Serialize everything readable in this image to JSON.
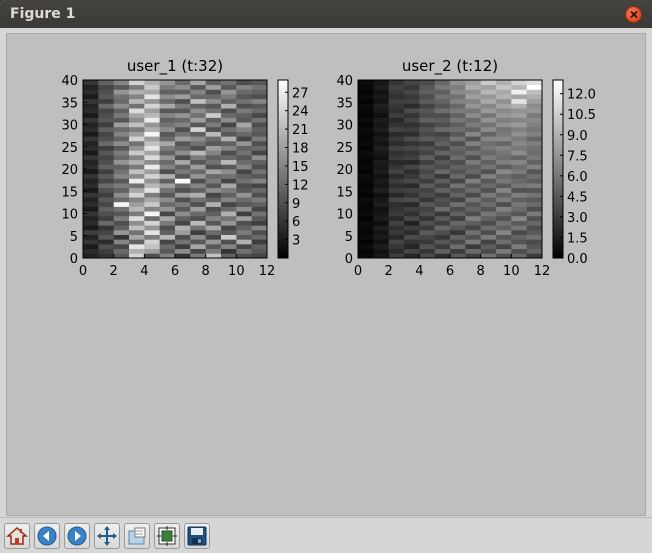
{
  "window": {
    "title": "Figure 1"
  },
  "toolbar": {
    "buttons": [
      {
        "name": "home-icon",
        "label": "Home"
      },
      {
        "name": "back-icon",
        "label": "Back"
      },
      {
        "name": "forward-icon",
        "label": "Forward"
      },
      {
        "name": "pan-icon",
        "label": "Pan"
      },
      {
        "name": "zoom-icon",
        "label": "Zoom"
      },
      {
        "name": "subplots-icon",
        "label": "Configure subplots"
      },
      {
        "name": "save-icon",
        "label": "Save"
      }
    ]
  },
  "chart_data": [
    {
      "type": "heatmap",
      "title": "user_1 (t:32)",
      "colormap": "gray",
      "xlim": [
        0,
        12
      ],
      "ylim": [
        0,
        40
      ],
      "x_ticks": [
        "0",
        "2",
        "4",
        "6",
        "8",
        "10",
        "12"
      ],
      "y_ticks": [
        "0",
        "5",
        "10",
        "15",
        "20",
        "25",
        "30",
        "35",
        "40"
      ],
      "colorbar": {
        "ticks": [
          "3",
          "6",
          "9",
          "12",
          "15",
          "18",
          "21",
          "24",
          "27"
        ],
        "range": [
          0,
          29
        ]
      },
      "values": [
        [
          4,
          6,
          10,
          24,
          9,
          15,
          6,
          14,
          22,
          11,
          9,
          8
        ],
        [
          5,
          7,
          12,
          20,
          18,
          10,
          16,
          8,
          14,
          6,
          13,
          10
        ],
        [
          3,
          9,
          8,
          26,
          22,
          12,
          7,
          19,
          10,
          15,
          8,
          11
        ],
        [
          6,
          5,
          15,
          11,
          24,
          8,
          13,
          10,
          17,
          9,
          20,
          7
        ],
        [
          4,
          10,
          6,
          19,
          14,
          21,
          9,
          16,
          8,
          23,
          10,
          12
        ],
        [
          7,
          8,
          17,
          13,
          26,
          11,
          18,
          7,
          12,
          10,
          14,
          9
        ],
        [
          3,
          6,
          11,
          22,
          17,
          9,
          20,
          13,
          19,
          8,
          11,
          15
        ],
        [
          5,
          12,
          9,
          16,
          24,
          14,
          8,
          21,
          10,
          17,
          9,
          7
        ],
        [
          4,
          7,
          14,
          25,
          12,
          19,
          11,
          9,
          15,
          13,
          18,
          10
        ],
        [
          6,
          9,
          10,
          14,
          28,
          8,
          16,
          12,
          11,
          20,
          7,
          13
        ],
        [
          3,
          11,
          13,
          21,
          15,
          17,
          10,
          18,
          9,
          12,
          16,
          8
        ],
        [
          5,
          8,
          28,
          18,
          23,
          12,
          14,
          9,
          20,
          8,
          10,
          11
        ],
        [
          4,
          10,
          12,
          15,
          19,
          16,
          9,
          13,
          11,
          15,
          12,
          14
        ],
        [
          6,
          7,
          16,
          24,
          14,
          10,
          18,
          20,
          8,
          11,
          17,
          9
        ],
        [
          3,
          9,
          11,
          19,
          26,
          13,
          9,
          11,
          16,
          14,
          10,
          12
        ],
        [
          5,
          12,
          14,
          13,
          21,
          18,
          12,
          15,
          10,
          19,
          9,
          8
        ],
        [
          4,
          8,
          10,
          27,
          17,
          11,
          29,
          9,
          14,
          8,
          13,
          15
        ],
        [
          6,
          10,
          15,
          16,
          24,
          20,
          10,
          17,
          12,
          13,
          11,
          10
        ],
        [
          3,
          7,
          13,
          22,
          18,
          9,
          14,
          12,
          19,
          16,
          8,
          13
        ],
        [
          5,
          11,
          11,
          14,
          27,
          15,
          11,
          18,
          9,
          10,
          15,
          9
        ],
        [
          4,
          9,
          17,
          20,
          16,
          12,
          19,
          10,
          13,
          21,
          12,
          11
        ],
        [
          6,
          8,
          12,
          15,
          25,
          17,
          9,
          14,
          11,
          12,
          10,
          16
        ],
        [
          3,
          10,
          14,
          23,
          19,
          11,
          16,
          21,
          15,
          9,
          13,
          8
        ],
        [
          5,
          7,
          10,
          17,
          26,
          14,
          12,
          9,
          18,
          15,
          11,
          12
        ],
        [
          4,
          12,
          16,
          13,
          22,
          19,
          10,
          13,
          10,
          11,
          17,
          9
        ],
        [
          6,
          9,
          11,
          24,
          18,
          12,
          18,
          16,
          12,
          20,
          8,
          14
        ],
        [
          3,
          8,
          15,
          18,
          28,
          10,
          13,
          11,
          21,
          10,
          12,
          10
        ],
        [
          5,
          11,
          12,
          14,
          20,
          16,
          9,
          24,
          9,
          13,
          15,
          11
        ],
        [
          4,
          7,
          18,
          22,
          17,
          13,
          15,
          10,
          14,
          8,
          19,
          9
        ],
        [
          6,
          10,
          10,
          16,
          27,
          11,
          12,
          18,
          11,
          16,
          10,
          13
        ],
        [
          3,
          9,
          14,
          19,
          21,
          15,
          17,
          13,
          23,
          12,
          11,
          8
        ],
        [
          5,
          8,
          11,
          25,
          18,
          10,
          10,
          16,
          13,
          9,
          14,
          12
        ],
        [
          4,
          12,
          16,
          13,
          24,
          19,
          14,
          11,
          10,
          20,
          9,
          10
        ],
        [
          6,
          7,
          12,
          21,
          17,
          12,
          9,
          22,
          16,
          11,
          13,
          15
        ],
        [
          3,
          10,
          13,
          15,
          26,
          16,
          18,
          12,
          12,
          14,
          10,
          9
        ],
        [
          5,
          9,
          17,
          20,
          19,
          11,
          11,
          15,
          9,
          17,
          12,
          11
        ],
        [
          4,
          8,
          10,
          14,
          23,
          14,
          16,
          10,
          18,
          10,
          15,
          13
        ],
        [
          6,
          11,
          15,
          24,
          20,
          17,
          12,
          19,
          11,
          13,
          9,
          10
        ]
      ]
    },
    {
      "type": "heatmap",
      "title": "user_2 (t:12)",
      "colormap": "gray",
      "xlim": [
        0,
        12
      ],
      "ylim": [
        0,
        40
      ],
      "x_ticks": [
        "0",
        "2",
        "4",
        "6",
        "8",
        "10",
        "12"
      ],
      "y_ticks": [
        "0",
        "5",
        "10",
        "15",
        "20",
        "25",
        "30",
        "35",
        "40"
      ],
      "colorbar": {
        "ticks": [
          "0.0",
          "1.5",
          "3.0",
          "4.5",
          "6.0",
          "7.5",
          "9.0",
          "10.5",
          "12.0"
        ],
        "range": [
          0,
          13
        ]
      },
      "values": [
        [
          0.4,
          1.2,
          3.1,
          2.0,
          3.8,
          2.4,
          4.6,
          3.2,
          5.9,
          4.1,
          5.2,
          3.0
        ],
        [
          0.3,
          0.9,
          2.2,
          3.5,
          2.7,
          4.9,
          3.1,
          5.4,
          3.8,
          6.2,
          4.0,
          5.1
        ],
        [
          0.6,
          1.5,
          2.8,
          1.9,
          4.2,
          3.0,
          5.6,
          2.9,
          4.8,
          3.5,
          6.4,
          4.4
        ],
        [
          0.2,
          0.8,
          3.4,
          2.6,
          2.9,
          4.4,
          3.7,
          6.1,
          3.4,
          5.6,
          4.3,
          3.8
        ],
        [
          0.5,
          1.3,
          2.0,
          3.8,
          3.5,
          2.8,
          5.0,
          4.2,
          6.3,
          4.4,
          5.1,
          5.7
        ],
        [
          0.3,
          1.0,
          2.9,
          2.3,
          4.6,
          3.9,
          2.8,
          5.7,
          4.0,
          6.8,
          3.7,
          4.6
        ],
        [
          0.4,
          1.6,
          2.4,
          3.1,
          3.0,
          5.2,
          4.4,
          3.6,
          5.5,
          4.9,
          6.0,
          3.9
        ],
        [
          0.6,
          0.7,
          3.3,
          1.8,
          4.1,
          3.3,
          5.3,
          4.8,
          3.9,
          5.8,
          4.6,
          5.3
        ],
        [
          0.2,
          1.4,
          2.1,
          3.6,
          2.6,
          4.6,
          3.2,
          6.4,
          5.0,
          4.2,
          6.9,
          4.1
        ],
        [
          0.5,
          1.1,
          3.0,
          2.5,
          3.9,
          2.9,
          4.9,
          3.9,
          6.0,
          5.3,
          4.4,
          6.2
        ],
        [
          0.3,
          0.9,
          2.6,
          3.2,
          3.3,
          5.5,
          3.8,
          5.1,
          4.3,
          6.6,
          5.5,
          4.0
        ],
        [
          0.4,
          1.5,
          2.3,
          2.1,
          4.5,
          3.7,
          5.7,
          4.4,
          5.6,
          3.9,
          6.1,
          5.4
        ],
        [
          0.6,
          1.2,
          3.5,
          3.9,
          2.8,
          4.2,
          3.4,
          6.0,
          4.7,
          6.3,
          4.9,
          4.5
        ],
        [
          0.2,
          0.8,
          2.0,
          2.7,
          4.0,
          3.1,
          5.1,
          3.7,
          6.2,
          5.0,
          6.5,
          5.9
        ],
        [
          0.5,
          1.6,
          3.2,
          3.4,
          3.4,
          5.0,
          4.1,
          5.6,
          4.1,
          6.9,
          4.2,
          4.3
        ],
        [
          0.3,
          1.0,
          2.4,
          2.2,
          4.7,
          3.5,
          5.8,
          4.5,
          5.4,
          4.6,
          6.0,
          6.3
        ],
        [
          0.4,
          1.3,
          3.1,
          3.7,
          3.1,
          4.8,
          3.6,
          6.5,
          4.5,
          6.1,
          5.3,
          4.8
        ],
        [
          0.6,
          0.9,
          2.2,
          2.9,
          4.3,
          2.9,
          5.4,
          3.8,
          6.6,
          5.4,
          4.8,
          5.6
        ],
        [
          0.2,
          1.5,
          3.4,
          2.4,
          3.6,
          5.3,
          4.3,
          5.3,
          4.2,
          7.0,
          6.2,
          4.4
        ],
        [
          0.5,
          1.1,
          2.7,
          3.5,
          4.4,
          3.8,
          5.0,
          4.9,
          5.9,
          4.7,
          5.5,
          6.6
        ],
        [
          0.3,
          1.4,
          2.1,
          2.0,
          3.2,
          4.5,
          3.9,
          6.2,
          4.9,
          6.4,
          6.8,
          5.0
        ],
        [
          0.4,
          0.8,
          3.0,
          3.3,
          4.8,
          3.2,
          5.5,
          4.1,
          6.3,
          5.6,
          5.1,
          6.1
        ],
        [
          0.6,
          1.2,
          2.5,
          2.8,
          3.5,
          5.1,
          4.7,
          5.8,
          5.3,
          6.0,
          7.2,
          5.5
        ],
        [
          0.2,
          1.6,
          3.3,
          3.6,
          4.1,
          3.6,
          5.2,
          4.6,
          6.1,
          6.7,
          6.1,
          5.8
        ],
        [
          0.5,
          1.0,
          2.3,
          2.6,
          3.0,
          4.9,
          4.0,
          6.6,
          5.6,
          5.2,
          6.9,
          6.4
        ],
        [
          0.3,
          1.3,
          2.9,
          3.9,
          4.6,
          4.3,
          5.9,
          4.3,
          6.8,
          6.9,
          6.3,
          5.2
        ],
        [
          0.4,
          0.9,
          2.2,
          2.3,
          3.7,
          3.4,
          4.5,
          6.9,
          5.1,
          6.2,
          7.4,
          6.7
        ],
        [
          0.6,
          1.5,
          3.4,
          3.1,
          4.2,
          5.4,
          5.6,
          5.0,
          7.1,
          5.9,
          6.6,
          6.0
        ],
        [
          0.2,
          1.1,
          2.6,
          2.5,
          3.3,
          4.0,
          4.8,
          6.3,
          5.8,
          7.3,
          7.8,
          6.5
        ],
        [
          0.5,
          1.4,
          2.0,
          3.4,
          4.9,
          4.7,
          6.0,
          5.5,
          7.5,
          6.4,
          6.8,
          7.0
        ],
        [
          0.3,
          0.8,
          3.1,
          2.7,
          3.9,
          3.9,
          5.0,
          7.2,
          6.0,
          7.7,
          8.1,
          6.2
        ],
        [
          0.4,
          1.2,
          2.4,
          3.8,
          4.4,
          5.6,
          6.2,
          6.0,
          7.9,
          7.0,
          7.5,
          7.6
        ],
        [
          0.6,
          1.6,
          2.8,
          2.2,
          3.4,
          4.4,
          5.3,
          7.6,
          6.9,
          8.3,
          9.0,
          7.1
        ],
        [
          0.2,
          1.0,
          3.2,
          3.3,
          4.7,
          5.0,
          6.6,
          6.8,
          8.6,
          7.4,
          11.6,
          8.0
        ],
        [
          0.5,
          1.3,
          2.5,
          2.9,
          4.0,
          5.7,
          5.8,
          8.1,
          7.7,
          9.1,
          8.5,
          8.9
        ],
        [
          0.3,
          0.9,
          2.9,
          3.6,
          4.9,
          4.8,
          7.0,
          7.3,
          9.4,
          8.6,
          12.3,
          9.7
        ],
        [
          0.4,
          1.5,
          3.3,
          2.8,
          4.5,
          6.1,
          6.4,
          8.8,
          8.2,
          10.1,
          9.3,
          13.0
        ],
        [
          0.6,
          1.1,
          2.7,
          3.5,
          3.8,
          5.3,
          7.4,
          8.0,
          10.3,
          9.0,
          10.8,
          11.4
        ]
      ]
    }
  ]
}
